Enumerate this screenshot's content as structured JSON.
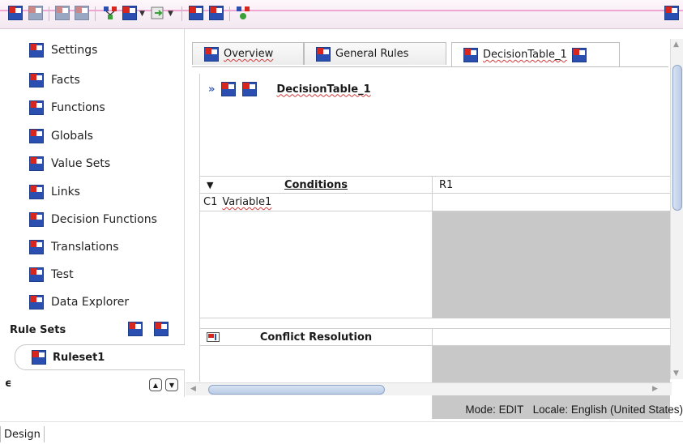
{
  "left_panel": {
    "items": [
      {
        "label": "Settings"
      },
      {
        "label": "Facts"
      },
      {
        "label": "Functions"
      },
      {
        "label": "Globals"
      },
      {
        "label": "Value Sets"
      },
      {
        "label": "Links"
      },
      {
        "label": "Decision Functions"
      },
      {
        "label": "Translations"
      },
      {
        "label": "Test"
      },
      {
        "label": "Data Explorer"
      }
    ],
    "rule_sets_label": "Rule Sets",
    "ruleset_name": "Ruleset1",
    "collapse_symbol": "ϵ"
  },
  "tabs": [
    {
      "label": "Overview"
    },
    {
      "label": "General Rules"
    },
    {
      "label": "DecisionTable_1"
    }
  ],
  "decision_table": {
    "title": "DecisionTable_1",
    "conditions_header": "Conditions",
    "rule_header": "R1",
    "condition_id": "C1",
    "condition_var": "Variable1",
    "conflict_header": "Conflict Resolution"
  },
  "status_bar": {
    "mode_text": "Mode: EDIT",
    "locale_text": "Locale: English (United States)"
  },
  "bottom_tab": {
    "label": "Design"
  },
  "colors": {
    "toolbar_accent": "#f1a5d3",
    "icon_blue": "#2a4fb0",
    "icon_red": "#d7261e",
    "grey_cell": "#c8c8c8"
  }
}
